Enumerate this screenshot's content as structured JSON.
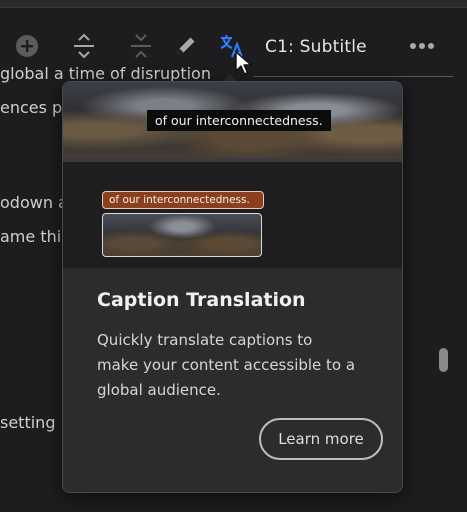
{
  "toolbar": {
    "track_label": "C1: Subtitle",
    "icons": [
      "add-icon",
      "expand-track-icon",
      "collapse-track-icon",
      "pencil-icon",
      "translate-icon",
      "more-icon"
    ],
    "accent_color": "#2d7ff9"
  },
  "background_text": {
    "line1": "global a time of disruption",
    "line2": "ences pa",
    "line3": "odown a",
    "line4": "ame thi",
    "line5": "setting",
    "line6": ""
  },
  "popover": {
    "hero_caption": "of our interconnectedness.",
    "mini_caption": "of our interconnectedness.",
    "title": "Caption Translation",
    "description": "Quickly translate captions to make your content accessible to a global audience.",
    "learn_more_label": "Learn more"
  }
}
